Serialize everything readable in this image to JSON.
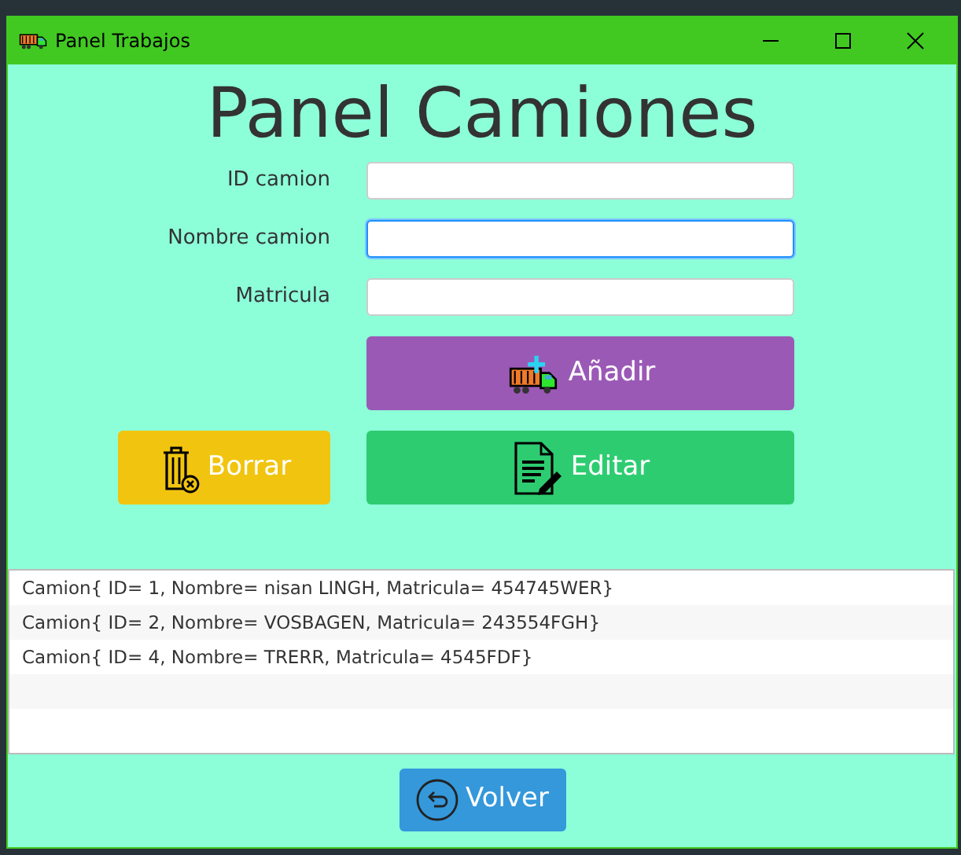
{
  "window": {
    "title": "Panel Trabajos"
  },
  "heading": "Panel Camiones",
  "fields": [
    {
      "label": "ID camion",
      "focused": false
    },
    {
      "label": "Nombre camion",
      "focused": true
    },
    {
      "label": "Matricula",
      "focused": false
    }
  ],
  "buttons": [
    {
      "kind": "add",
      "label": "Añadir"
    },
    {
      "kind": "delete",
      "label": "Borrar"
    },
    {
      "kind": "edit",
      "label": "Editar"
    }
  ],
  "list": {
    "items": [
      "Camion{ ID= 1, Nombre= nisan LINGH, Matricula= 454745WER}",
      "Camion{ ID= 2, Nombre= VOSBAGEN, Matricula= 243554FGH}",
      "Camion{ ID= 4, Nombre= TRERR, Matricula= 4545FDF}"
    ]
  },
  "back_button": {
    "label": "Volver"
  }
}
